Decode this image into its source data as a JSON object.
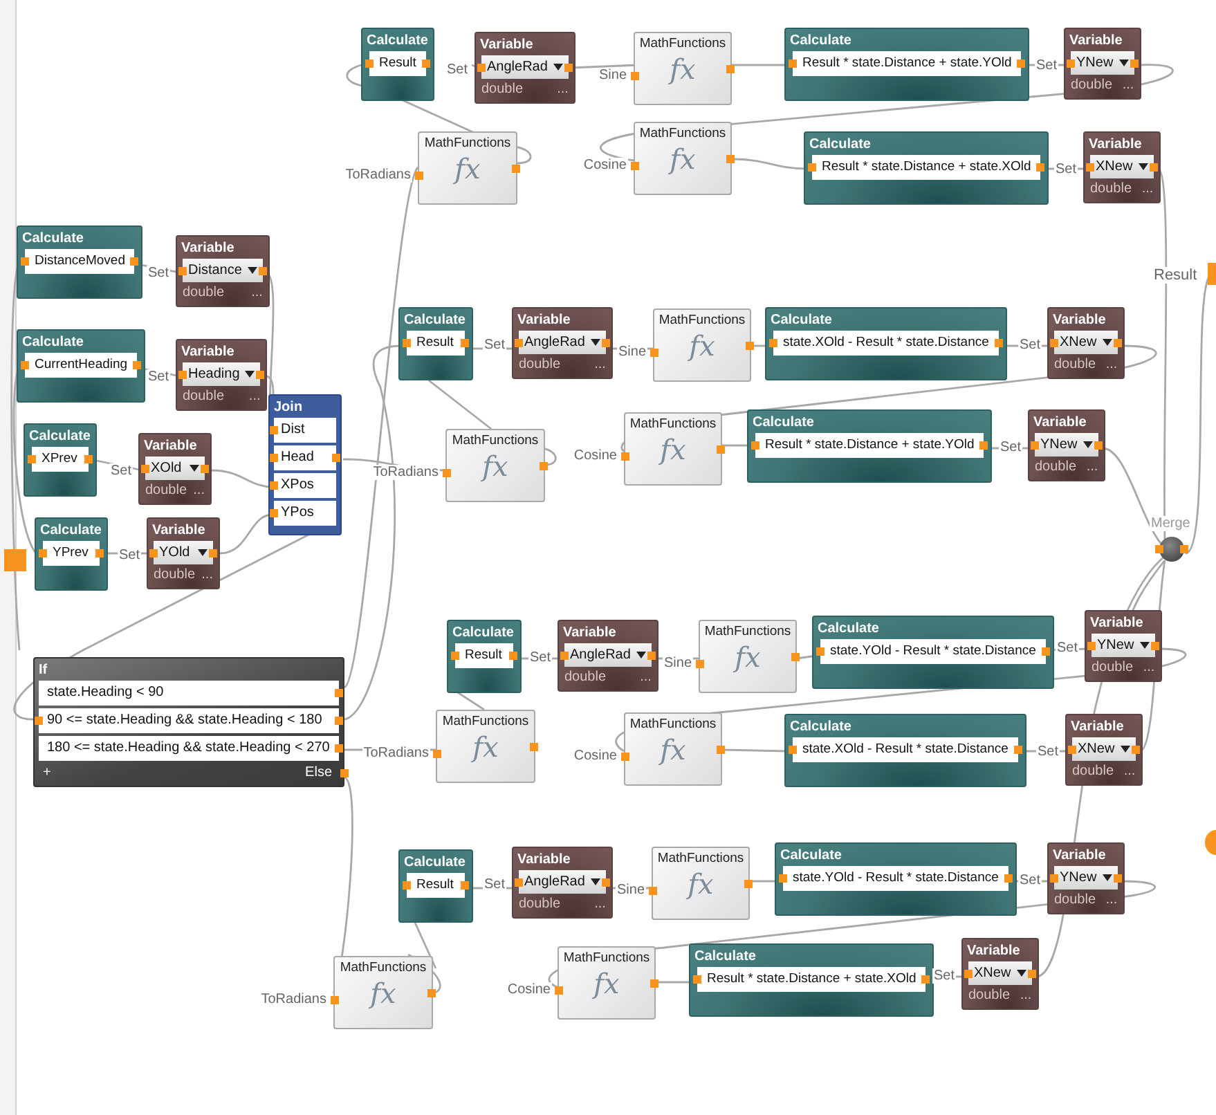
{
  "nodes": [
    {
      "kind": "calculate",
      "title": "Calculate",
      "expression": "Result"
    },
    {
      "kind": "variable",
      "title": "Variable",
      "input_label": "Set",
      "value": "AngleRad",
      "type": "double",
      "more": "..."
    },
    {
      "kind": "math",
      "title": "MathFunctions",
      "input_label": "Sine",
      "symbol": "fx"
    },
    {
      "kind": "calculate",
      "title": "Calculate",
      "expression": "Result * state.Distance + state.YOld"
    },
    {
      "kind": "variable",
      "title": "Variable",
      "input_label": "Set",
      "value": "YNew",
      "type": "double",
      "more": "..."
    },
    {
      "kind": "math",
      "title": "MathFunctions",
      "input_label": "ToRadians",
      "symbol": "fx"
    },
    {
      "kind": "math",
      "title": "MathFunctions",
      "input_label": "Cosine",
      "symbol": "fx"
    },
    {
      "kind": "calculate",
      "title": "Calculate",
      "expression": "Result * state.Distance + state.XOld"
    },
    {
      "kind": "variable",
      "title": "Variable",
      "input_label": "Set",
      "value": "XNew",
      "type": "double",
      "more": "..."
    },
    {
      "kind": "calculate",
      "title": "Calculate",
      "expression": "DistanceMoved"
    },
    {
      "kind": "variable",
      "title": "Variable",
      "input_label": "Set",
      "value": "Distance",
      "type": "double",
      "more": "..."
    },
    {
      "kind": "calculate",
      "title": "Calculate",
      "expression": "CurrentHeading"
    },
    {
      "kind": "variable",
      "title": "Variable",
      "input_label": "Set",
      "value": "Heading",
      "type": "double",
      "more": "..."
    },
    {
      "kind": "calculate",
      "title": "Calculate",
      "expression": "XPrev"
    },
    {
      "kind": "variable",
      "title": "Variable",
      "input_label": "Set",
      "value": "XOld",
      "type": "double",
      "more": "..."
    },
    {
      "kind": "calculate",
      "title": "Calculate",
      "expression": "YPrev"
    },
    {
      "kind": "variable",
      "title": "Variable",
      "input_label": "Set",
      "value": "YOld",
      "type": "double",
      "more": "..."
    },
    {
      "kind": "join",
      "title": "Join",
      "fields": [
        "Dist",
        "Head",
        "XPos",
        "YPos"
      ]
    },
    {
      "kind": "if",
      "title": "If",
      "conditions": [
        "state.Heading < 90",
        "90 <= state.Heading && state.Heading < 180",
        "180 <= state.Heading && state.Heading < 270"
      ],
      "add": "+",
      "else": "Else"
    },
    {
      "kind": "calculate",
      "title": "Calculate",
      "expression": "Result"
    },
    {
      "kind": "variable",
      "title": "Variable",
      "input_label": "Set",
      "value": "AngleRad",
      "type": "double",
      "more": "..."
    },
    {
      "kind": "math",
      "title": "MathFunctions",
      "input_label": "Sine",
      "symbol": "fx"
    },
    {
      "kind": "calculate",
      "title": "Calculate",
      "expression": "state.XOld - Result * state.Distance"
    },
    {
      "kind": "variable",
      "title": "Variable",
      "input_label": "Set",
      "value": "XNew",
      "type": "double",
      "more": "..."
    },
    {
      "kind": "math",
      "title": "MathFunctions",
      "input_label": "ToRadians",
      "symbol": "fx"
    },
    {
      "kind": "math",
      "title": "MathFunctions",
      "input_label": "Cosine",
      "symbol": "fx"
    },
    {
      "kind": "calculate",
      "title": "Calculate",
      "expression": "Result * state.Distance + state.YOld"
    },
    {
      "kind": "variable",
      "title": "Variable",
      "input_label": "Set",
      "value": "YNew",
      "type": "double",
      "more": "..."
    },
    {
      "kind": "calculate",
      "title": "Calculate",
      "expression": "Result"
    },
    {
      "kind": "variable",
      "title": "Variable",
      "input_label": "Set",
      "value": "AngleRad",
      "type": "double",
      "more": "..."
    },
    {
      "kind": "math",
      "title": "MathFunctions",
      "input_label": "Sine",
      "symbol": "fx"
    },
    {
      "kind": "calculate",
      "title": "Calculate",
      "expression": "state.YOld - Result * state.Distance"
    },
    {
      "kind": "variable",
      "title": "Variable",
      "input_label": "Set",
      "value": "YNew",
      "type": "double",
      "more": "..."
    },
    {
      "kind": "math",
      "title": "MathFunctions",
      "input_label": "ToRadians",
      "symbol": "fx"
    },
    {
      "kind": "math",
      "title": "MathFunctions",
      "input_label": "Cosine",
      "symbol": "fx"
    },
    {
      "kind": "calculate",
      "title": "Calculate",
      "expression": "state.XOld - Result * state.Distance"
    },
    {
      "kind": "variable",
      "title": "Variable",
      "input_label": "Set",
      "value": "XNew",
      "type": "double",
      "more": "..."
    },
    {
      "kind": "calculate",
      "title": "Calculate",
      "expression": "Result"
    },
    {
      "kind": "variable",
      "title": "Variable",
      "input_label": "Set",
      "value": "AngleRad",
      "type": "double",
      "more": "..."
    },
    {
      "kind": "math",
      "title": "MathFunctions",
      "input_label": "Sine",
      "symbol": "fx"
    },
    {
      "kind": "calculate",
      "title": "Calculate",
      "expression": "state.YOld - Result * state.Distance"
    },
    {
      "kind": "variable",
      "title": "Variable",
      "input_label": "Set",
      "value": "YNew",
      "type": "double",
      "more": "..."
    },
    {
      "kind": "math",
      "title": "MathFunctions",
      "input_label": "ToRadians",
      "symbol": "fx"
    },
    {
      "kind": "math",
      "title": "MathFunctions",
      "input_label": "Cosine",
      "symbol": "fx"
    },
    {
      "kind": "calculate",
      "title": "Calculate",
      "expression": "Result * state.Distance + state.XOld"
    },
    {
      "kind": "variable",
      "title": "Variable",
      "input_label": "Set",
      "value": "XNew",
      "type": "double",
      "more": "..."
    }
  ],
  "merge": {
    "label": "Merge"
  },
  "output": {
    "label": "Result"
  }
}
